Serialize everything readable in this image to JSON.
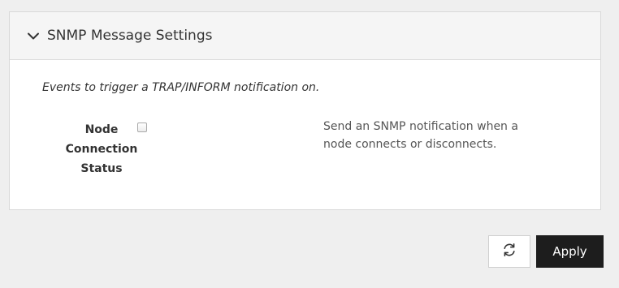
{
  "panel": {
    "title": "SNMP Message Settings",
    "collapse_icon": "chevron-down-icon",
    "help_text": "Events to trigger a TRAP/INFORM notification on.",
    "field": {
      "label_line1": "Node",
      "label_line2": "Connection",
      "label_line3": "Status",
      "checked": false,
      "description_line1": "Send an SNMP notification when a",
      "description_line2": "node connects or disconnects."
    }
  },
  "actions": {
    "refresh_icon": "refresh-icon",
    "apply_label": "Apply"
  },
  "colors": {
    "page_background": "#efefef",
    "panel_header_background": "#f5f5f5",
    "apply_button_background": "#1d1d1d"
  }
}
